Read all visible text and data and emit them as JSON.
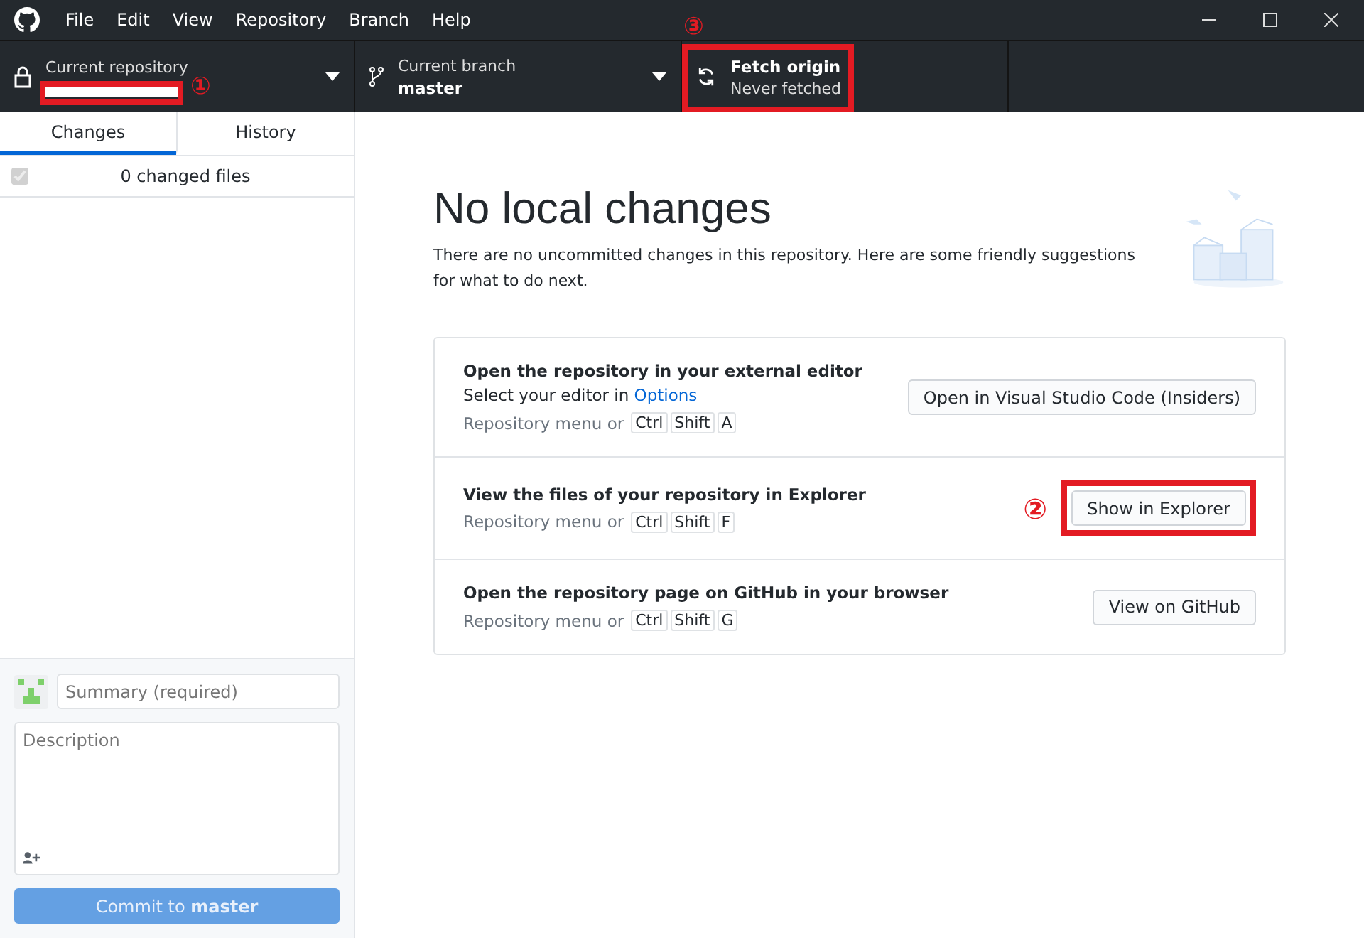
{
  "menu": [
    "File",
    "Edit",
    "View",
    "Repository",
    "Branch",
    "Help"
  ],
  "toolbar": {
    "repository": {
      "label": "Current repository",
      "marker": "①"
    },
    "branch": {
      "label": "Current branch",
      "name": "master"
    },
    "fetch": {
      "title": "Fetch origin",
      "subtitle": "Never fetched",
      "marker": "③"
    }
  },
  "tabs": [
    {
      "label": "Changes",
      "selected": true
    },
    {
      "label": "History",
      "selected": false
    }
  ],
  "changes": {
    "summary": "0 changed files",
    "checked": true,
    "disabled": true
  },
  "commit": {
    "summary_placeholder": "Summary (required)",
    "description_placeholder": "Description",
    "button_prefix": "Commit to ",
    "button_branch": "master",
    "disabled": true
  },
  "main": {
    "heading": "No local changes",
    "intro": "There are no uncommitted changes in this repository. Here are some friendly suggestions for what to do next.",
    "suggestions": [
      {
        "title": "Open the repository in your external editor",
        "hint_prefix": "Select your editor in ",
        "hint_link": "Options",
        "shortcut_prefix": "Repository menu or",
        "keys": [
          "Ctrl",
          "Shift",
          "A"
        ],
        "button": "Open in Visual Studio Code (Insiders)"
      },
      {
        "title": "View the files of your repository in Explorer",
        "shortcut_prefix": "Repository menu or",
        "keys": [
          "Ctrl",
          "Shift",
          "F"
        ],
        "button": "Show in Explorer",
        "marker": "②"
      },
      {
        "title": "Open the repository page on GitHub in your browser",
        "shortcut_prefix": "Repository menu or",
        "keys": [
          "Ctrl",
          "Shift",
          "G"
        ],
        "button": "View on GitHub"
      }
    ]
  }
}
